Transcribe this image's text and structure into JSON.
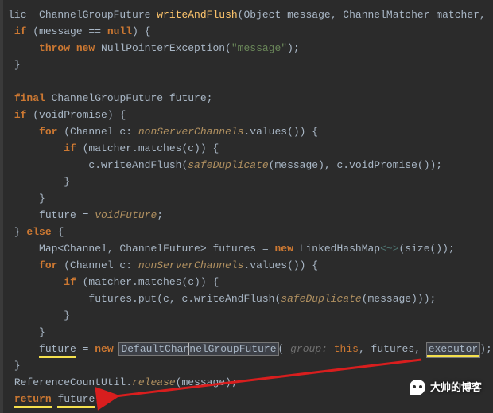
{
  "code": {
    "l1": {
      "a": "lic ",
      "b": " ChannelGroupFuture ",
      "c": "writeAndFlush",
      "d": "(Object message, ChannelMatcher matcher,"
    },
    "l2": {
      "a": "if",
      "b": " (message == ",
      "c": "null",
      "d": ") {"
    },
    "l3": {
      "a": "throw new",
      "b": " NullPointerException(",
      "c": "\"message\"",
      "d": ");"
    },
    "l4": "}",
    "l6": {
      "a": "final",
      "b": " ChannelGroupFuture future;"
    },
    "l7": {
      "a": "if",
      "b": " (voidPromise) {"
    },
    "l8": {
      "a": "for",
      "b": " (Channel c: ",
      "c": "nonServerChannels",
      "d": ".values()) {"
    },
    "l9": {
      "a": "if",
      "b": " (matcher.matches(c)) {"
    },
    "l10": {
      "a": "c.writeAndFlush(",
      "b": "safeDuplicate",
      "c": "(message), c.voidPromise());"
    },
    "l11": "}",
    "l12": "}",
    "l13": {
      "a": "future = ",
      "b": "voidFuture",
      "c": ";"
    },
    "l14": {
      "a": "} ",
      "b": "else",
      "c": " {"
    },
    "l15": {
      "a": "Map<Channel, ChannelFuture> futures = ",
      "b": "new",
      "c": " LinkedHashMap",
      "d": "<~>",
      "e": "(size());"
    },
    "l16": {
      "a": "for",
      "b": " (Channel c: ",
      "c": "nonServerChannels",
      "d": ".values()) {"
    },
    "l17": {
      "a": "if",
      "b": " (matcher.matches(c)) {"
    },
    "l18": {
      "a": "futures.put(c, c.writeAndFlush(",
      "b": "safeDuplicate",
      "c": "(message)));"
    },
    "l19": "}",
    "l20": "}",
    "l21": {
      "a": "future",
      "b": " = ",
      "c": "new",
      "d": " ",
      "e": "DefaultChan",
      "f": "nelGroupFuture",
      "g": "( ",
      "h": "group:",
      "i": " ",
      "j": "this",
      "k": ", futures, ",
      "l": "executor",
      "m": ");"
    },
    "l22": "}",
    "l23": {
      "a": "ReferenceCountUtil.",
      "b": "release",
      "c": "(message);"
    },
    "l24": {
      "a": "return",
      "b": " ",
      "c": "future",
      "d": ";"
    }
  },
  "watermark": "大帅的博客"
}
